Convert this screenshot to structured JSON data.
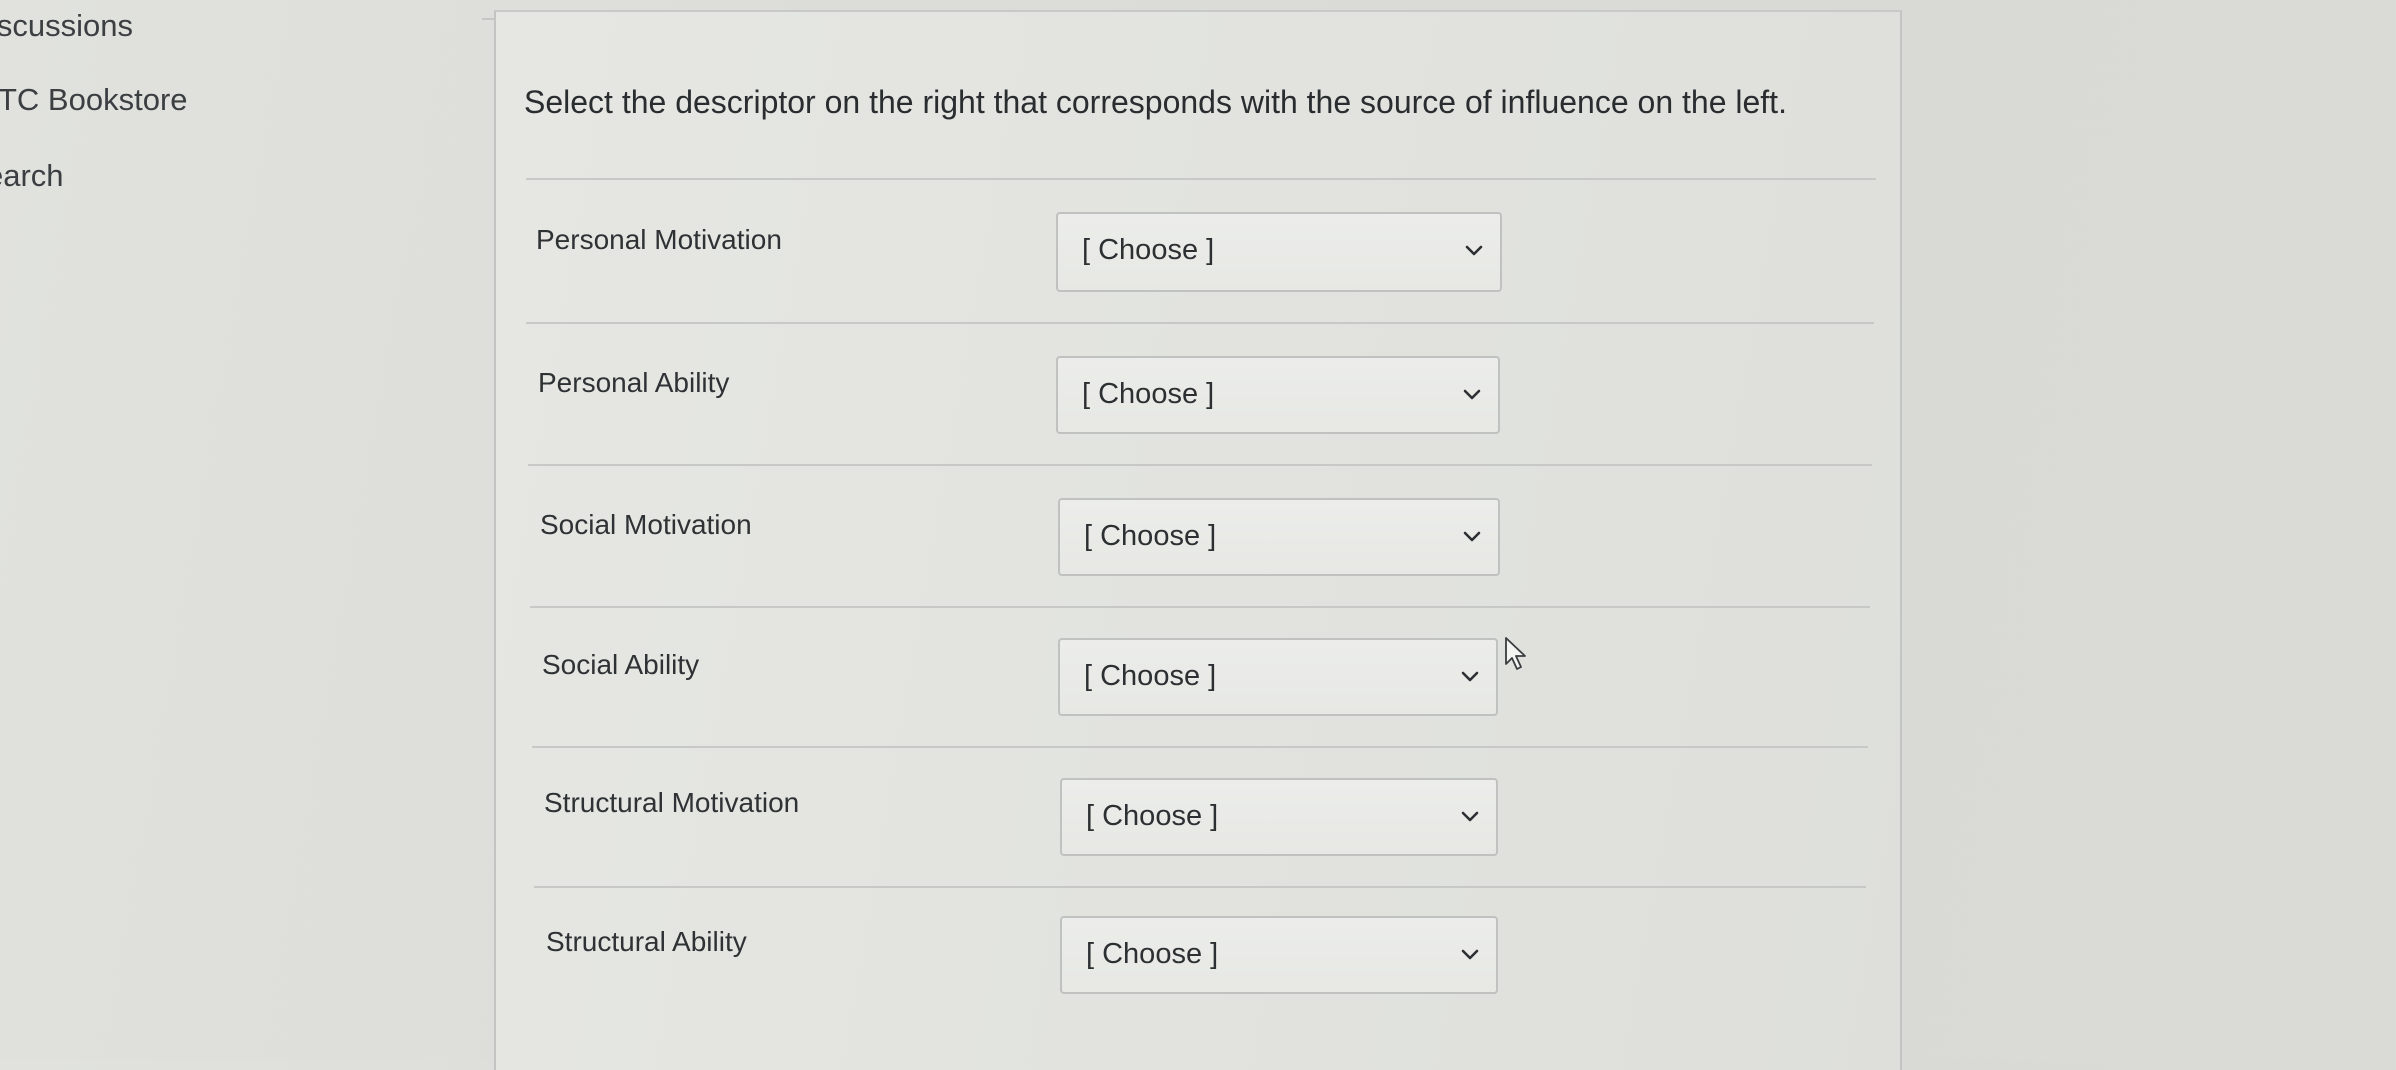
{
  "sidebar": {
    "items": [
      {
        "label": "iscussions"
      },
      {
        "label": "TC Bookstore"
      },
      {
        "label": "earch"
      }
    ]
  },
  "question": {
    "prompt": "Select the descriptor on the right that corresponds with the source of influence on the left.",
    "rows": [
      {
        "label": "Personal Motivation",
        "selected": "[ Choose ]"
      },
      {
        "label": "Personal Ability",
        "selected": "[ Choose ]"
      },
      {
        "label": "Social Motivation",
        "selected": "[ Choose ]"
      },
      {
        "label": "Social Ability",
        "selected": "[ Choose ]"
      },
      {
        "label": "Structural Motivation",
        "selected": "[ Choose ]"
      },
      {
        "label": "Structural Ability",
        "selected": "[ Choose ]"
      }
    ]
  },
  "icons": {
    "select_arrow": "chevron-down-icon",
    "pointer": "mouse-cursor-icon"
  },
  "colors": {
    "background": "#dcdcd8",
    "panel": "#e3e4e0",
    "border": "#c0c2bf",
    "text": "#2b2e30"
  }
}
